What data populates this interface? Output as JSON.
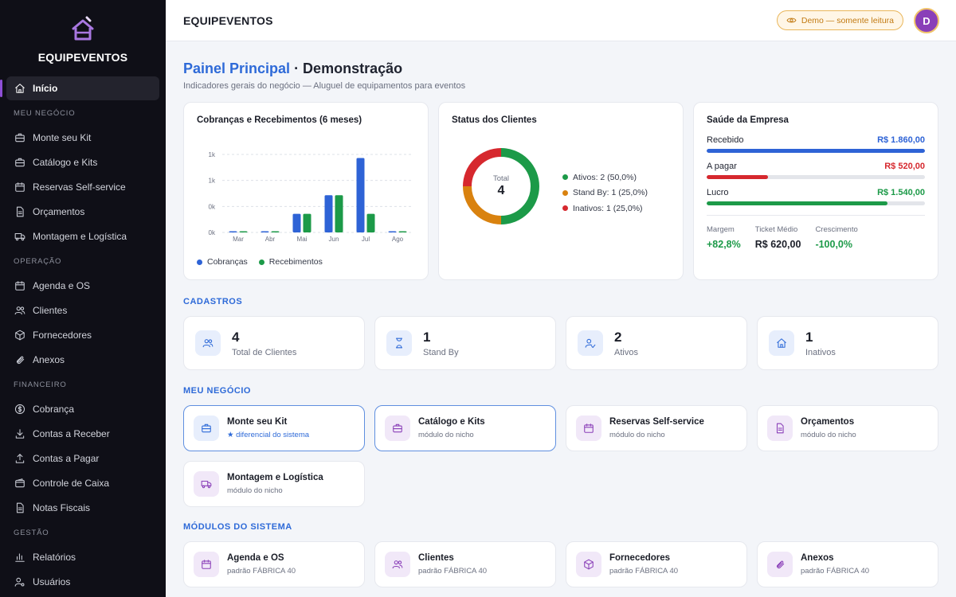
{
  "app": {
    "name": "EQUIPEVENTOS"
  },
  "sidebar": {
    "home": "Início",
    "sections": [
      {
        "title": "MEU NEGÓCIO",
        "items": [
          "Monte seu Kit",
          "Catálogo e Kits",
          "Reservas Self-service",
          "Orçamentos",
          "Montagem e Logística"
        ]
      },
      {
        "title": "OPERAÇÃO",
        "items": [
          "Agenda e OS",
          "Clientes",
          "Fornecedores",
          "Anexos"
        ]
      },
      {
        "title": "FINANCEIRO",
        "items": [
          "Cobrança",
          "Contas a Receber",
          "Contas a Pagar",
          "Controle de Caixa",
          "Notas Fiscais"
        ]
      },
      {
        "title": "GESTÃO",
        "items": [
          "Relatórios",
          "Usuários"
        ]
      }
    ]
  },
  "header": {
    "title": "EQUIPEVENTOS",
    "demo_badge": "Demo — somente leitura",
    "avatar_letter": "D"
  },
  "page": {
    "title_accent": "Painel Principal",
    "title_rest": " · Demonstração",
    "subtitle": "Indicadores gerais do negócio — Aluguel de equipamentos para eventos"
  },
  "charts": {
    "billing": {
      "title": "Cobranças e Recebimentos (6 meses)"
    },
    "clients": {
      "title": "Status dos Clientes"
    }
  },
  "chart_data": [
    {
      "type": "bar",
      "title": "Cobranças e Recebimentos (6 meses)",
      "categories": [
        "Mar",
        "Abr",
        "Mai",
        "Jun",
        "Jul",
        "Ago"
      ],
      "y_tick_labels": [
        "0k",
        "0k",
        "1k",
        "1k"
      ],
      "ylim": [
        0,
        1300
      ],
      "series": [
        {
          "name": "Cobranças",
          "color": "#2e63d6",
          "values": [
            0,
            0,
            310,
            620,
            1240,
            0
          ]
        },
        {
          "name": "Recebimentos",
          "color": "#1c9a48",
          "values": [
            0,
            0,
            310,
            620,
            310,
            0
          ]
        }
      ],
      "legend": "bottom-left",
      "grid": true
    },
    {
      "type": "pie",
      "title": "Status dos Clientes",
      "center_label": "Total",
      "center_value": "4",
      "slices": [
        {
          "label": "Ativos: 2 (50,0%)",
          "value": 2,
          "color": "#1c9a48"
        },
        {
          "label": "Stand By: 1 (25,0%)",
          "value": 1,
          "color": "#d9820f"
        },
        {
          "label": "Inativos: 1 (25,0%)",
          "value": 1,
          "color": "#d6282e"
        }
      ]
    }
  ],
  "health": {
    "title": "Saúde da Empresa",
    "rows": [
      {
        "label": "Recebido",
        "value": "R$ 1.860,00",
        "color": "#2e63d6",
        "fill": 1.0
      },
      {
        "label": "A pagar",
        "value": "R$ 520,00",
        "color": "#d6282e",
        "fill": 0.28
      },
      {
        "label": "Lucro",
        "value": "R$ 1.540,00",
        "color": "#1c9a48",
        "fill": 0.83
      }
    ],
    "metrics": [
      {
        "label": "Margem",
        "value": "+82,8%",
        "color": "#1c9a48"
      },
      {
        "label": "Ticket Médio",
        "value": "R$ 620,00",
        "color": "#1b1e28"
      },
      {
        "label": "Crescimento",
        "value": "-100,0%",
        "color": "#1c9a48"
      }
    ]
  },
  "cadastros": {
    "title": "CADASTROS",
    "stats": [
      {
        "value": "4",
        "label": "Total de Clientes",
        "icon": "users-icon"
      },
      {
        "value": "1",
        "label": "Stand By",
        "icon": "hourglass-icon"
      },
      {
        "value": "2",
        "label": "Ativos",
        "icon": "user-check-icon"
      },
      {
        "value": "1",
        "label": "Inativos",
        "icon": "home-icon"
      }
    ]
  },
  "meu_negocio": {
    "title": "MEU NEGÓCIO",
    "cards": [
      {
        "title": "Monte seu Kit",
        "subtitle": "★ diferencial do sistema",
        "icon": "briefcase-icon"
      },
      {
        "title": "Catálogo e Kits",
        "subtitle": "módulo do nicho",
        "icon": "briefcase-icon"
      },
      {
        "title": "Reservas Self-service",
        "subtitle": "módulo do nicho",
        "icon": "calendar-icon"
      },
      {
        "title": "Orçamentos",
        "subtitle": "módulo do nicho",
        "icon": "document-icon"
      },
      {
        "title": "Montagem e Logística",
        "subtitle": "módulo do nicho",
        "icon": "truck-icon"
      }
    ]
  },
  "modulos": {
    "title": "MÓDULOS DO SISTEMA",
    "cards": [
      {
        "title": "Agenda e OS",
        "subtitle": "padrão FÁBRICA 40",
        "icon": "calendar-icon"
      },
      {
        "title": "Clientes",
        "subtitle": "padrão FÁBRICA 40",
        "icon": "users-icon"
      },
      {
        "title": "Fornecedores",
        "subtitle": "padrão FÁBRICA 40",
        "icon": "box-icon"
      },
      {
        "title": "Anexos",
        "subtitle": "padrão FÁBRICA 40",
        "icon": "paperclip-icon"
      }
    ]
  }
}
